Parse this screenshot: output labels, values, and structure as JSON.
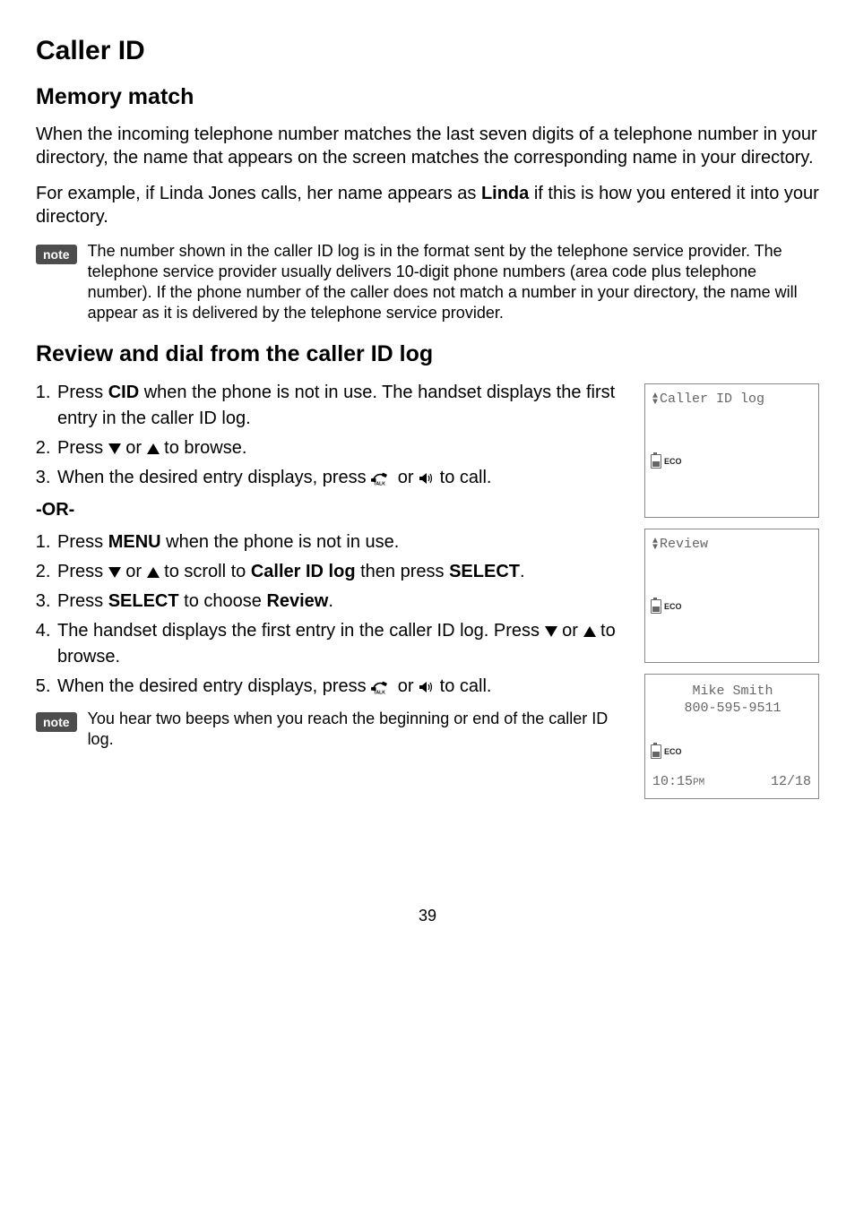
{
  "title": "Caller ID",
  "section1": {
    "heading": "Memory match",
    "para1": "When the incoming telephone number matches the last seven digits of a telephone number in your directory, the name that appears on the screen matches the corresponding name in your directory.",
    "para2_pre": "For example, if Linda Jones calls, her name appears as ",
    "para2_bold": "Linda",
    "para2_post": " if this is how you entered it into your directory.",
    "note_badge": "note",
    "note_text": "The number shown in the caller ID log is in the format sent by the telephone service provider. The telephone service provider usually delivers 10-digit phone numbers (area code plus telephone number). If the phone number of the caller does not match a number in your directory, the name will appear as it is delivered by the telephone service provider."
  },
  "section2": {
    "heading": "Review and dial from the caller ID log",
    "steps_a": {
      "s1_pre": "Press ",
      "s1_bold": "CID",
      "s1_post": " when the phone is not in use. The handset displays the first entry in the caller ID log.",
      "s2_pre": "Press ",
      "s2_mid": " or ",
      "s2_post": " to browse.",
      "s3_pre": "When the desired entry displays, press ",
      "s3_mid": " or ",
      "s3_post": " to call."
    },
    "or_label": "-OR-",
    "steps_b": {
      "s1_pre": "Press ",
      "s1_bold": "MENU",
      "s1_post": " when the phone is not in use.",
      "s2_pre": "Press ",
      "s2_mid": " or ",
      "s2_mid2": " to scroll to ",
      "s2_bold": "Caller ID log",
      "s2_mid3": " then press ",
      "s2_bold2": "SELECT",
      "s2_post": ".",
      "s3_pre": "Press ",
      "s3_bold": "SELECT",
      "s3_mid": " to choose ",
      "s3_bold2": "Review",
      "s3_post": ".",
      "s4_pre": "The handset displays the first entry in the caller ID log. Press ",
      "s4_mid": " or ",
      "s4_post": " to browse.",
      "s5_pre": "When the desired entry displays, press ",
      "s5_mid": " or ",
      "s5_post": " to call."
    },
    "note_badge": "note",
    "note_text": "You hear two beeps when you reach the beginning or end of the caller ID log."
  },
  "screens": {
    "s1_title": "Caller ID log",
    "s2_title": "Review",
    "s3_name": "Mike Smith",
    "s3_number": "800-595-9511",
    "s3_time": "10:15",
    "s3_ampm": "PM",
    "s3_date": "12/18",
    "eco": "ECO"
  },
  "page_number": "39"
}
